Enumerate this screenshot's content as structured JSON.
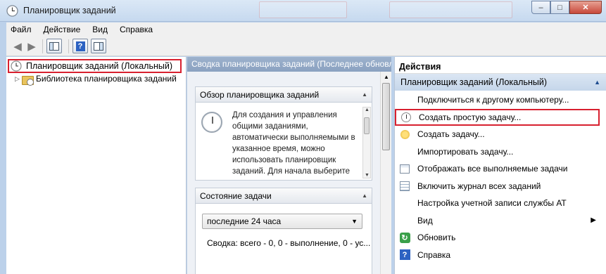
{
  "window": {
    "title": "Планировщик заданий",
    "controls": {
      "minimize": "–",
      "maximize": "□",
      "close": "✕"
    }
  },
  "menu": [
    "Файл",
    "Действие",
    "Вид",
    "Справка"
  ],
  "toolbar": {
    "back_icon": "arrow-left-icon",
    "forward_icon": "arrow-right-icon",
    "buttons": [
      "console-tree-icon",
      "help-icon",
      "action-pane-icon"
    ],
    "help_glyph": "?"
  },
  "tree": {
    "root": "Планировщик заданий (Локальный)",
    "child": "Библиотека планировщика заданий"
  },
  "summary": {
    "header": "Сводка планировщика заданий (Последнее обновл",
    "overview": {
      "title": "Обзор планировщика заданий",
      "text": "Для создания и управления общими заданиями, автоматически выполняемыми в указанное время, можно использовать планировщик заданий. Для начала выберите команду в"
    },
    "status": {
      "title": "Состояние задачи",
      "period": "последние 24 часа",
      "summary": "Сводка: всего - 0, 0 - выполнение, 0 - ус..."
    }
  },
  "actions": {
    "title": "Действия",
    "group": "Планировщик заданий (Локальный)",
    "items": [
      {
        "label": "Подключиться к другому компьютеру...",
        "icon": "none"
      },
      {
        "label": "Создать простую задачу...",
        "icon": "clock-icon"
      },
      {
        "label": "Создать задачу...",
        "icon": "sun-icon"
      },
      {
        "label": "Импортировать задачу...",
        "icon": "none"
      },
      {
        "label": "Отображать все выполняемые задачи",
        "icon": "calendar-icon"
      },
      {
        "label": "Включить журнал всех заданий",
        "icon": "list-icon"
      },
      {
        "label": "Настройка учетной записи службы AT",
        "icon": "none"
      },
      {
        "label": "Вид",
        "icon": "none"
      },
      {
        "label": "Обновить",
        "icon": "refresh-icon"
      },
      {
        "label": "Справка",
        "icon": "help-icon"
      }
    ]
  },
  "colors": {
    "highlight": "#d8202f",
    "header_blue": "#8aa1c0"
  }
}
